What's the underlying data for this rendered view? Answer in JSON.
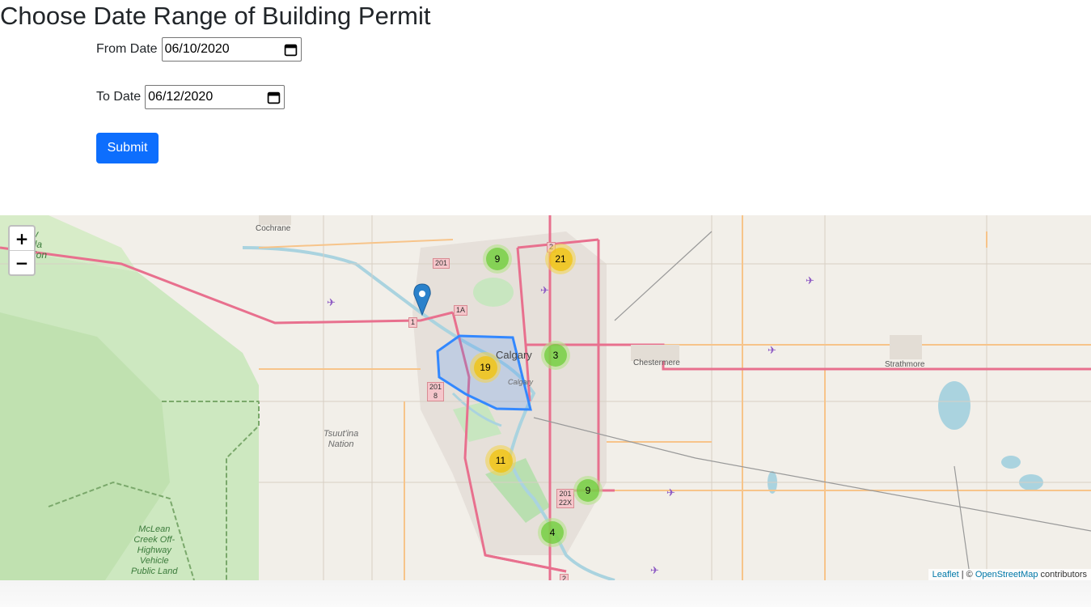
{
  "page": {
    "title": "Choose Date Range of Building Permit"
  },
  "form": {
    "from_label": "From Date",
    "from_value": "06/10/2020",
    "to_label": "To Date",
    "to_value": "06/12/2020",
    "submit_label": "Submit"
  },
  "map": {
    "zoom_in": "+",
    "zoom_out": "−",
    "attribution": {
      "leaflet": "Leaflet",
      "sep": " | © ",
      "osm": "OpenStreetMap",
      "suffix": " contributors"
    },
    "place_labels": {
      "cochrane": "Cochrane",
      "calgary": "Calgary",
      "calgary_small": "Calgary",
      "chestermere": "Chestermere",
      "strathmore": "Strathmore",
      "tsuutina": "Tsuut'ina\nNation",
      "mclean": "McLean\nCreek Off-\nHighway\nVehicle\nPublic Land",
      "valley_partial": "ley\nada\nation"
    },
    "shields": {
      "s201a": "201",
      "s1a": "1A",
      "s1": "1",
      "s201b": "201\n8",
      "s201c": "201\n22X",
      "s2top": "2",
      "s2bot": "2"
    },
    "clusters": [
      {
        "count": "9",
        "level": "small"
      },
      {
        "count": "21",
        "level": "medium"
      },
      {
        "count": "3",
        "level": "small"
      },
      {
        "count": "19",
        "level": "medium"
      },
      {
        "count": "11",
        "level": "medium"
      },
      {
        "count": "9",
        "level": "small"
      },
      {
        "count": "4",
        "level": "small"
      }
    ],
    "colors": {
      "cluster_small_outer": "#b5e28c",
      "cluster_small_inner": "#6ecc39",
      "cluster_medium_outer": "#f1d357",
      "cluster_medium_inner": "#f0c20c",
      "polygon": "#3388ff"
    }
  }
}
